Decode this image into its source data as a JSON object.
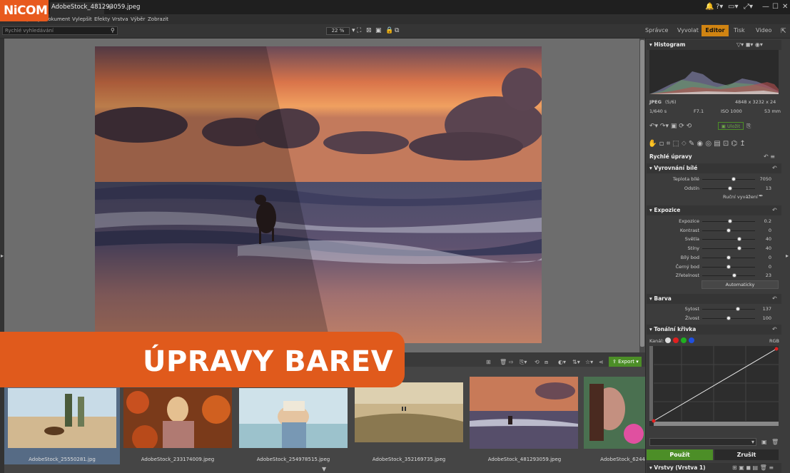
{
  "app": {
    "logo": "NiCOM",
    "file_tab": "AdobeStock_481293059.jpeg",
    "add_tab": "+"
  },
  "menu": [
    "Soubor",
    "Úpravy",
    "Dokument",
    "Vylepšit",
    "Efekty",
    "Vrstva",
    "Výběr",
    "Zobrazit"
  ],
  "toolbar": {
    "search_placeholder": "Rychlé vyhledávání",
    "zoom": "22 %"
  },
  "modes": {
    "manager": "Správce",
    "develop": "Vyvolat",
    "editor": "Editor",
    "print": "Tisk",
    "video": "Video"
  },
  "histogram": {
    "title": "Histogram",
    "format": "JPEG",
    "index": "(5/6)",
    "dimensions": "4848 x 3232 x 24",
    "shutter": "1/640 s",
    "aperture": "F7.1",
    "iso": "ISO 1000",
    "focal": "53 mm"
  },
  "colors": {
    "accent": "#d08412",
    "apply": "#4c8e27",
    "banner": "#e05a1c"
  },
  "quick_adjust": {
    "title": "Rychlé úpravy"
  },
  "white_balance": {
    "title": "Vyrovnání bílé",
    "rows": [
      {
        "label": "Teplota bílé",
        "value": "7050",
        "pos": 0.6
      },
      {
        "label": "Odstín",
        "value": "13",
        "pos": 0.53
      }
    ],
    "manual": "Ruční vyvážení"
  },
  "exposure": {
    "title": "Expozice",
    "rows": [
      {
        "label": "Expozice",
        "value": "0.2",
        "pos": 0.53
      },
      {
        "label": "Kontrast",
        "value": "0",
        "pos": 0.5
      },
      {
        "label": "Světla",
        "value": "40",
        "pos": 0.7
      },
      {
        "label": "Stíny",
        "value": "40",
        "pos": 0.7
      },
      {
        "label": "Bílý bod",
        "value": "0",
        "pos": 0.5
      },
      {
        "label": "Černý bod",
        "value": "0",
        "pos": 0.5
      },
      {
        "label": "Zřetelnost",
        "value": "23",
        "pos": 0.61
      }
    ],
    "auto": "Automaticky"
  },
  "color": {
    "title": "Barva",
    "rows": [
      {
        "label": "Sytost",
        "value": "137",
        "pos": 0.68
      },
      {
        "label": "Živost",
        "value": "100",
        "pos": 0.5
      }
    ]
  },
  "tone_curve": {
    "title": "Tonální křivka",
    "channels_label": "Kanál:",
    "mode": "RGB"
  },
  "actions": {
    "apply": "Použít",
    "cancel": "Zrušit"
  },
  "layers": {
    "title": "Vrstvy (Vrstva 1)"
  },
  "filmstrip": {
    "export": "Export",
    "items": [
      {
        "name": "AdobeStock_25550281.jpg"
      },
      {
        "name": "AdobeStock_233174009.jpeg"
      },
      {
        "name": "AdobeStock_254978515.jpeg"
      },
      {
        "name": "AdobeStock_352169735.jpeg"
      },
      {
        "name": "AdobeStock_481293059.jpeg"
      },
      {
        "name": "AdobeStock_6244"
      }
    ]
  },
  "banner": {
    "text": "ÚPRAVY BAREV"
  }
}
